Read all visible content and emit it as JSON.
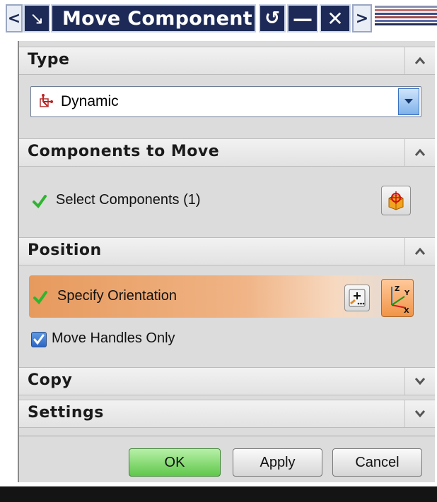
{
  "window": {
    "title": "Move Component",
    "back_glyph": "<",
    "forward_glyph": ">",
    "reset_glyph": "↺",
    "minimize_glyph": "—",
    "close_glyph": "✕",
    "title_icon_glyph": "↘"
  },
  "sections": {
    "type": {
      "title": "Type",
      "expanded": true,
      "dropdown_value": "Dynamic",
      "dropdown_icon": "dynamic-csys-icon"
    },
    "components": {
      "title": "Components to Move",
      "expanded": true,
      "select_label": "Select Components (1)",
      "select_button_icon": "component-select-icon"
    },
    "position": {
      "title": "Position",
      "expanded": true,
      "orientation_label": "Specify Orientation",
      "point_button_icon": "point-dialog-icon",
      "csys_button_icon": "csys-xyz-icon",
      "move_handles_label": "Move Handles Only",
      "move_handles_checked": true
    },
    "copy": {
      "title": "Copy",
      "expanded": false
    },
    "settings": {
      "title": "Settings",
      "expanded": false
    }
  },
  "buttons": {
    "ok": "OK",
    "apply": "Apply",
    "cancel": "Cancel"
  },
  "colors": {
    "titlebar": "#1d2a57",
    "panel": "#dcdcdc",
    "highlight": "#e79a5d",
    "ok_green": "#5fc84a",
    "check_green": "#2fb52f"
  }
}
